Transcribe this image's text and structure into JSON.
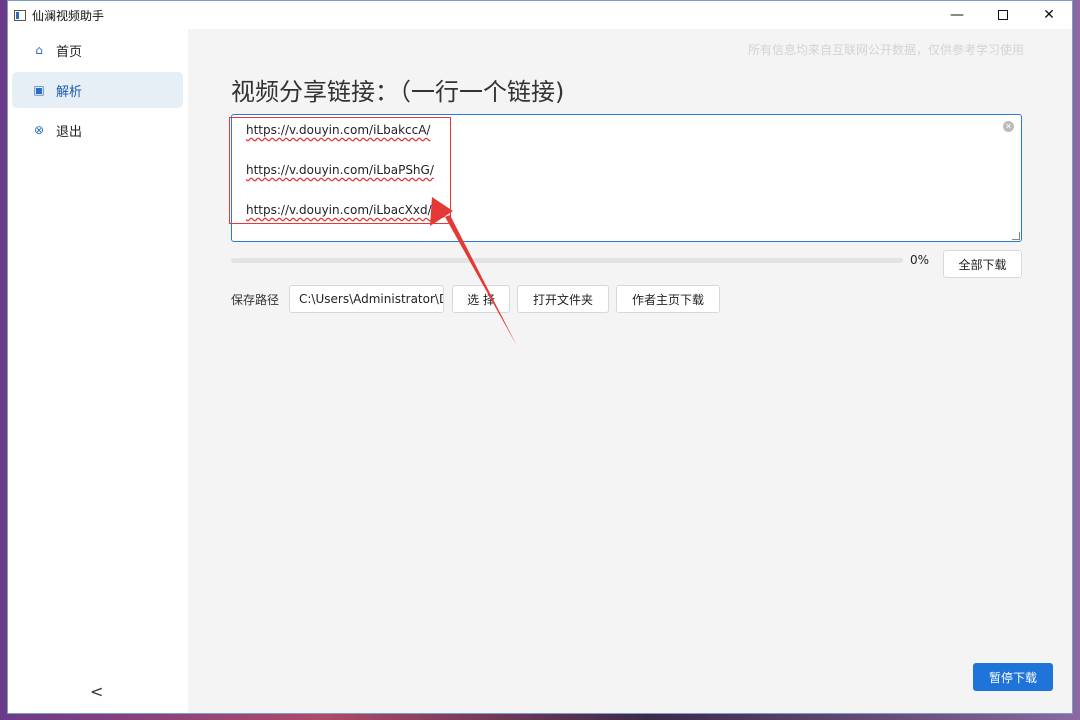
{
  "window": {
    "title": "仙澜视频助手",
    "controls": {
      "minimize": "—",
      "close": "✕"
    }
  },
  "sidebar": {
    "items": [
      {
        "label": "首页",
        "icon": "home-icon",
        "active": false
      },
      {
        "label": "解析",
        "icon": "parse-icon",
        "active": true
      },
      {
        "label": "退出",
        "icon": "exit-icon",
        "active": false
      }
    ],
    "collapse_glyph": "<"
  },
  "main": {
    "notice": "所有信息均来自互联网公开数据，仅供参考学习使用",
    "heading": "视频分享链接：（一行一个链接)",
    "links": [
      "https://v.douyin.com/iLbakccA/",
      "https://v.douyin.com/iLbaPShG/",
      "https://v.douyin.com/iLbacXxd/"
    ],
    "progress": {
      "value": 0,
      "text": "0%"
    },
    "download_all_label": "全部下载",
    "save_path_label": "保存路径",
    "save_path_value": "C:\\Users\\Administrator\\D",
    "choose_label": "选 择",
    "open_folder_label": "打开文件夹",
    "author_download_label": "作者主页下载",
    "pause_download_label": "暂停下载"
  },
  "colors": {
    "accent": "#1e74d8",
    "annotation": "#e53935"
  }
}
